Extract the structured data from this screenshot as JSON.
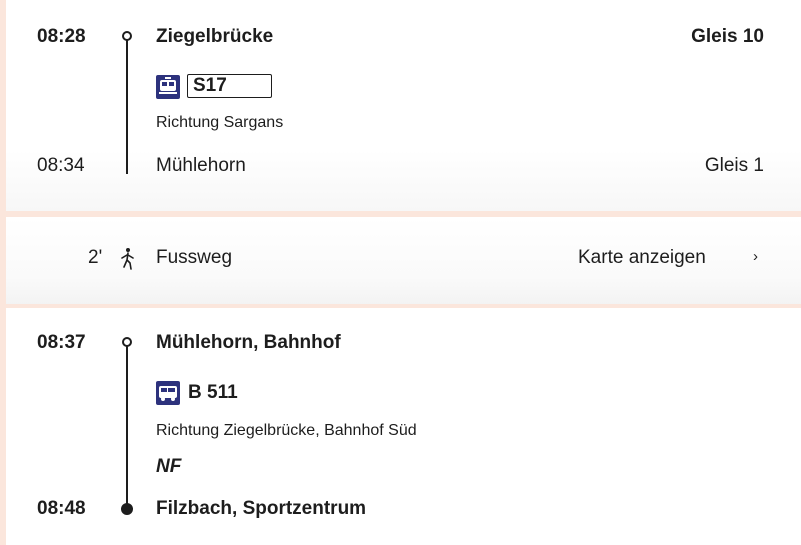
{
  "legs": [
    {
      "dep_time": "08:28",
      "dep_stop": "Ziegelbrücke",
      "dep_platform": "Gleis 10",
      "mode_icon": "train-icon",
      "line": "S17",
      "direction": "Richtung Sargans",
      "arr_time": "08:34",
      "arr_stop": "Mühlehorn",
      "arr_platform": "Gleis 1"
    },
    {
      "dep_time": "08:37",
      "dep_stop": "Mühlehorn, Bahnhof",
      "mode_icon": "bus-icon",
      "line": "B 511",
      "direction": "Richtung Ziegelbrücke, Bahnhof Süd",
      "note": "NF",
      "arr_time": "08:48",
      "arr_stop": "Filzbach, Sportzentrum"
    }
  ],
  "walk": {
    "duration": "2'",
    "icon": "walking-person-icon",
    "label": "Fussweg",
    "map_link": "Karte anzeigen",
    "chevron": "›"
  },
  "colors": {
    "background": "#fbe6dc",
    "card": "#ffffff",
    "mode_icon_bg": "#2d327d",
    "text": "#1d1d1d"
  }
}
